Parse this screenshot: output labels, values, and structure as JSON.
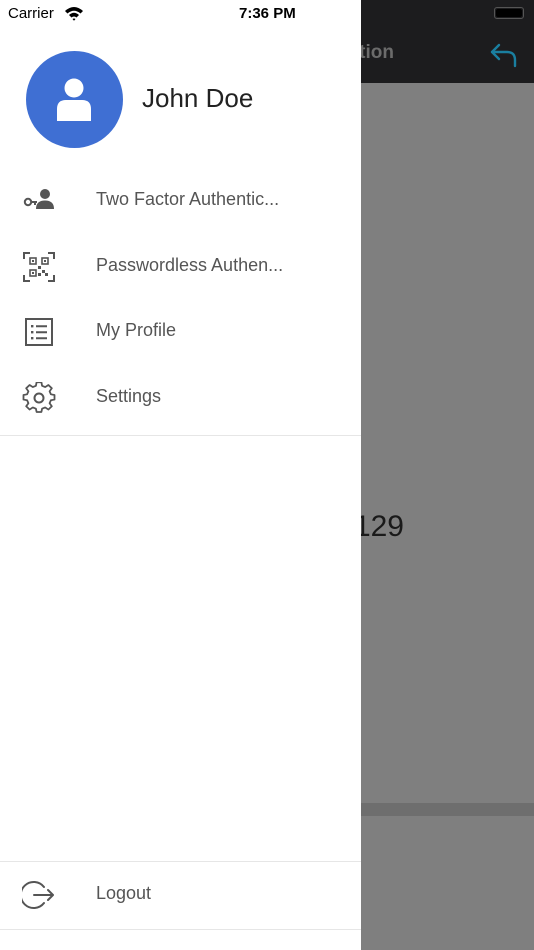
{
  "status_bar": {
    "carrier": "Carrier",
    "time": "7:36 PM"
  },
  "background": {
    "title_fragment": "tion",
    "code_fragment": "129"
  },
  "user": {
    "name": "John Doe",
    "avatar_color": "#3f6fd3"
  },
  "menu": {
    "items": [
      {
        "label": "Two Factor Authentic...",
        "icon": "key-user-icon"
      },
      {
        "label": "Passwordless Authen...",
        "icon": "qr-code-icon"
      },
      {
        "label": "My Profile",
        "icon": "list-icon"
      },
      {
        "label": "Settings",
        "icon": "gear-icon"
      }
    ],
    "logout": {
      "label": "Logout",
      "icon": "logout-icon"
    }
  },
  "colors": {
    "accent": "#3f6fd3",
    "back_arrow": "#1a7fa0",
    "icon_gray": "#555555"
  }
}
